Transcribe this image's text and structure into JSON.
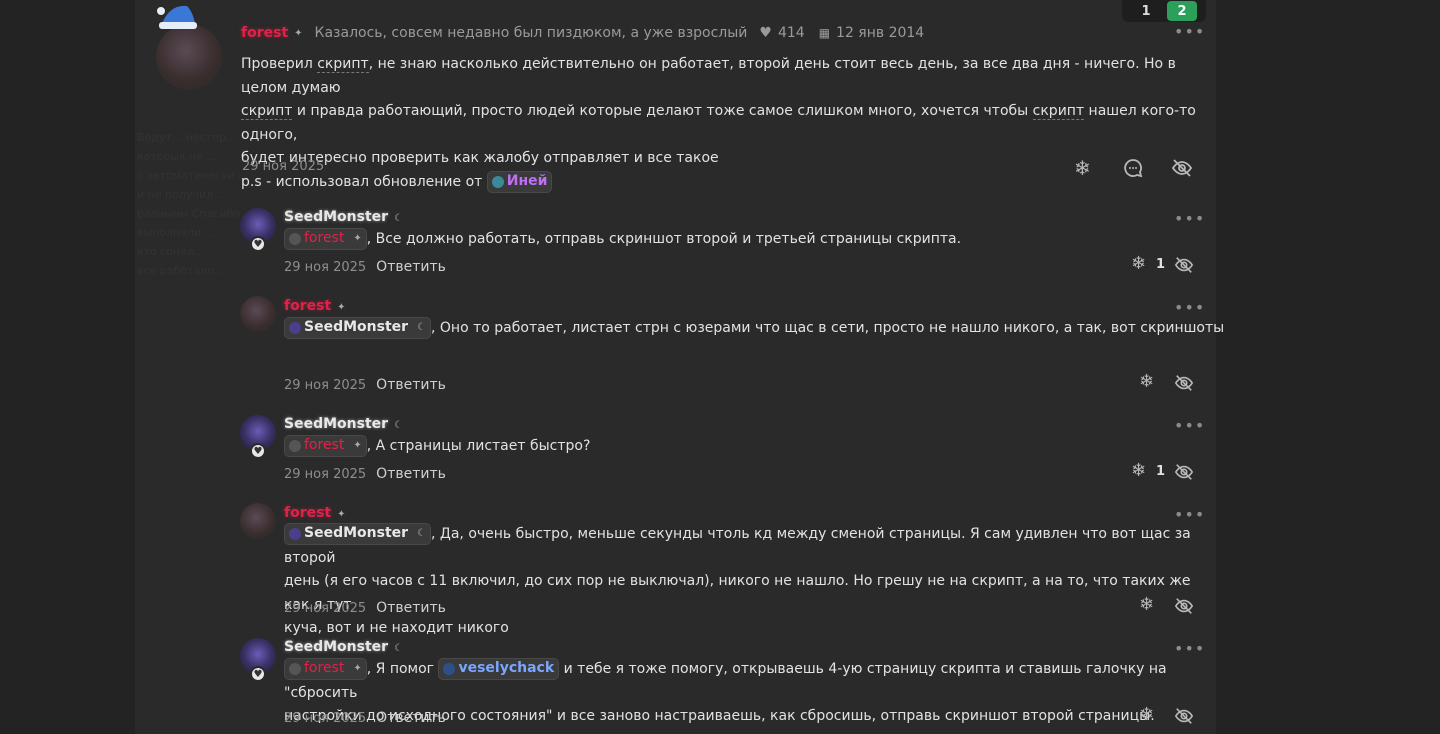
{
  "pagination": {
    "pages": [
      "1",
      "2"
    ],
    "active": "2"
  },
  "ghost_lines": [
    "Ведут... нестер...",
    "которых не ...",
    "с автоматически ...",
    "и не получил ...",
    "разныны Спасибо ...",
    "выполняли ...",
    "кто гонял...",
    "все работало..."
  ],
  "post": {
    "author": "forest",
    "author_star": "✦",
    "status": "Казалось, совсем недавно был пиздюком, а уже взрослый",
    "likes": "414",
    "joined": "12 янв 2014",
    "lines": [
      [
        "Проверил ",
        {
          "u": "скрипт"
        },
        ", не знаю насколько действительно он работает, второй день стоит весь день, за все два дня - ничего. Но в целом думаю"
      ],
      [
        {
          "u": "скрипт"
        },
        " и правда работающий, просто людей которые делают тоже самое слишком много, хочется чтобы ",
        {
          "u": "скрипт"
        },
        " нашел кого-то одного,"
      ],
      [
        "будет интересно проверить как жалобу отправляет и все такое"
      ]
    ],
    "ps_prefix": "p.s - использовал обновление от ",
    "ps_mention": "Иней",
    "date": "29 ноя 2025"
  },
  "comments": [
    {
      "author": "SeedMonster",
      "kind": "seed",
      "mention": "forest",
      "mention_kind": "red",
      "text": [
        ", Все должно работать, отправь скриншот второй и третьей страницы скрипта."
      ],
      "date": "29 ноя 2025",
      "reply": "Ответить",
      "likes": "1"
    },
    {
      "author": "forest",
      "kind": "forest",
      "mention": "SeedMonster",
      "mention_kind": "white",
      "text": [
        ", Оно то работает, листает стрн с юзерами что щас в сети, просто не нашло никого, а так, вот скриншоты"
      ],
      "date": "29 ноя 2025",
      "reply": "Ответить",
      "likes": ""
    },
    {
      "author": "SeedMonster",
      "kind": "seed",
      "mention": "forest",
      "mention_kind": "red",
      "text": [
        ", А страницы листает быстро?"
      ],
      "date": "29 ноя 2025",
      "reply": "Ответить",
      "likes": "1"
    },
    {
      "author": "forest",
      "kind": "forest",
      "mention": "SeedMonster",
      "mention_kind": "white",
      "text": [
        ", Да, очень быстро, меньше секунды чтоль кд между сменой страницы. Я сам удивлен что вот щас за второй",
        "день (я его часов с 11 включил, до сих пор не выключал), никого не нашло. Но грешу не на скрипт, а на то, что таких же как я тут",
        "куча, вот и не находит никого"
      ],
      "date": "29 ноя 2025",
      "reply": "Ответить",
      "likes": ""
    },
    {
      "author": "SeedMonster",
      "kind": "seed",
      "mention": "forest",
      "mention_kind": "red",
      "text_a": ", Я помог ",
      "mention2": "veselychack",
      "text_b": " и тебе я тоже помогу, открываешь 4-ую страницу скрипта и ставишь галочку на \"сбросить",
      "text_c": "настройки до исходного состояния\" и все заново настраиваешь, как сбросишь, отправь скриншот второй страницы.",
      "date": "29 ноя 2025",
      "reply": "Ответить",
      "likes": ""
    }
  ]
}
